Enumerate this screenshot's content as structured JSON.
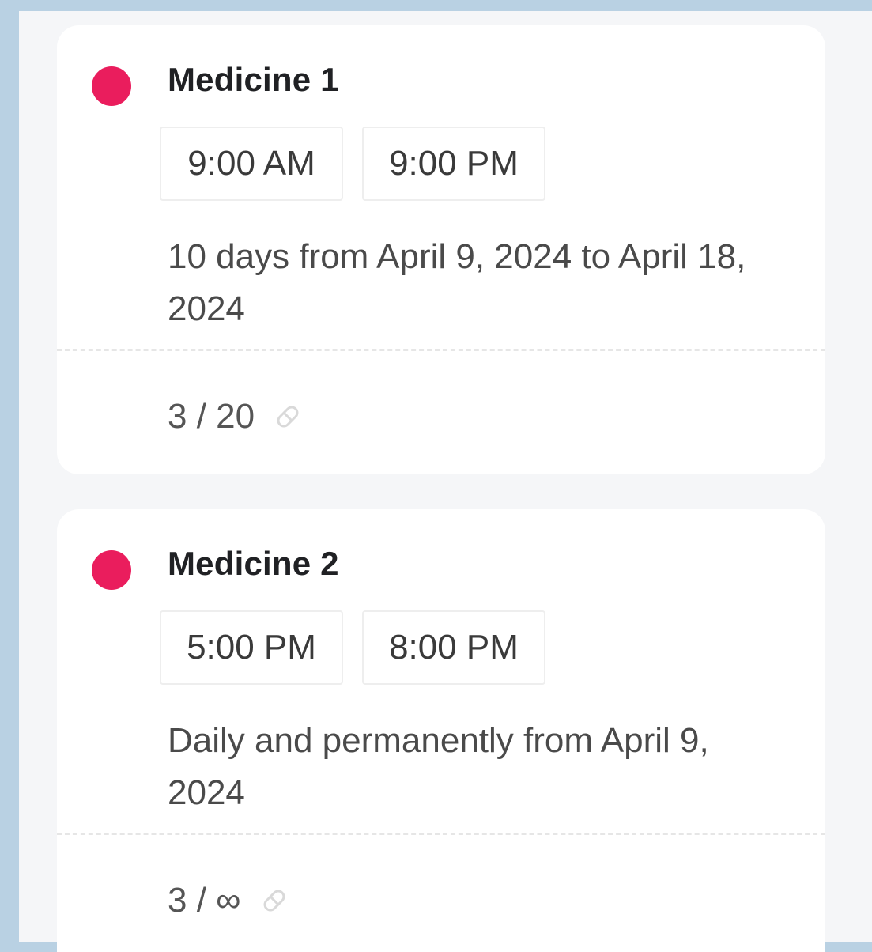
{
  "colors": {
    "accent_dot": "#ea1d5d",
    "background": "#f5f6f8",
    "frame_border": "#b9d1e3"
  },
  "medicines": [
    {
      "name": "Medicine 1",
      "times": [
        "9:00 AM",
        "9:00 PM"
      ],
      "schedule": "10 days from April 9, 2024 to April 18, 2024",
      "count": "3 / 20",
      "icon": "pill-icon"
    },
    {
      "name": "Medicine 2",
      "times": [
        "5:00 PM",
        "8:00 PM"
      ],
      "schedule": "Daily and permanently from April 9, 2024",
      "count": "3 / ∞",
      "icon": "pill-icon"
    }
  ]
}
